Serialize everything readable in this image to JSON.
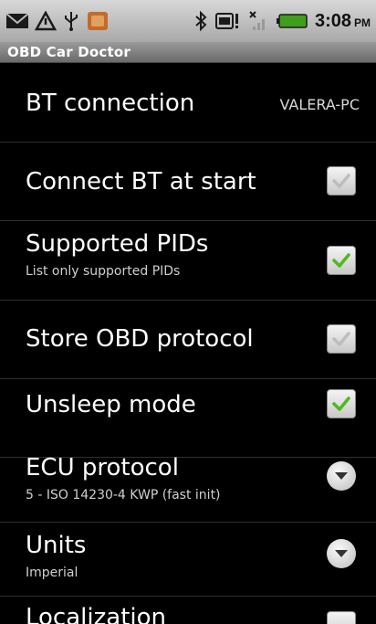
{
  "status_bar": {
    "time": "3:08",
    "ampm": "PM",
    "icons": [
      "email-icon",
      "warning-icon",
      "usb-icon",
      "app-icon",
      "bluetooth-icon",
      "phone-battery-icon",
      "no-signal-icon",
      "battery-icon"
    ]
  },
  "app": {
    "title": "OBD Car Doctor"
  },
  "settings": [
    {
      "title": "BT connection",
      "value": "VALERA-PC"
    },
    {
      "title": "Connect BT at start",
      "checked": false
    },
    {
      "title": "Supported PIDs",
      "summary": "List only supported PIDs",
      "checked": true
    },
    {
      "title": "Store OBD protocol",
      "checked": false
    },
    {
      "title": "Unsleep mode",
      "checked": true
    },
    {
      "title": "ECU protocol",
      "summary": "5 - ISO 14230-4 KWP (fast init)"
    },
    {
      "title": "Units",
      "summary": "Imperial"
    },
    {
      "title": "Localization"
    }
  ],
  "colors": {
    "check_green": "#52b81e",
    "background": "#000000"
  }
}
